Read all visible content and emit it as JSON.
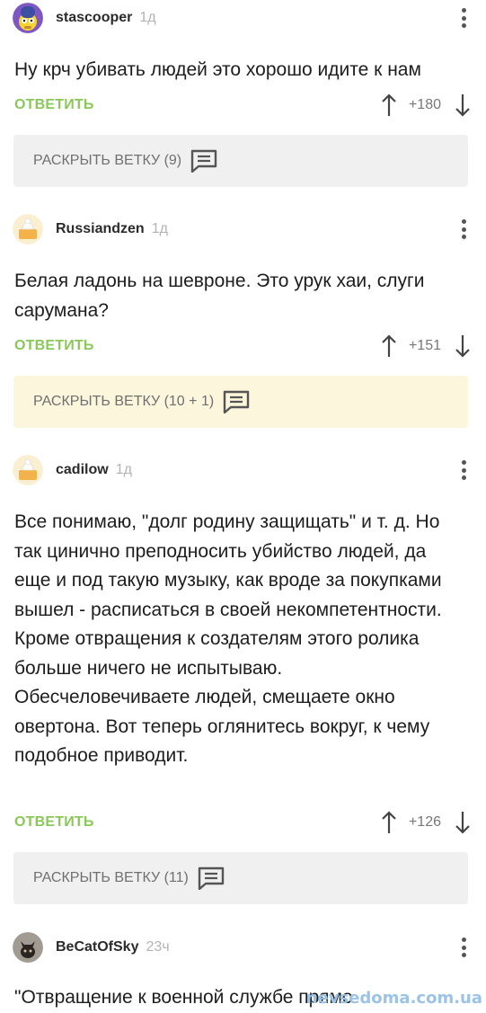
{
  "comments": [
    {
      "author": "stascooper",
      "time": "1д",
      "text": "Ну крч убивать людей это хорошо идите к нам",
      "reply_label": "ОТВЕТИТЬ",
      "score": "+180",
      "branch_label": "РАСКРЫТЬ ВЕТКУ (9)",
      "branch_color": "#f0f0f0"
    },
    {
      "author": "Russiandzen",
      "time": "1д",
      "text": "Белая ладонь на шевроне. Это урук хаи, слуги сарумана?",
      "reply_label": "ОТВЕТИТЬ",
      "score": "+151",
      "branch_label": "РАСКРЫТЬ ВЕТКУ (10 + 1)",
      "branch_color": "#fbf6dc"
    },
    {
      "author": "cadilow",
      "time": "1д",
      "text": "Все понимаю, \"долг родину защищать\" и т. д. Но так цинично преподносить убийство людей, да еще и под такую музыку, как вроде за покупками вышел - расписаться в своей некомпетентности. Кроме отвращения к создателям этого ролика больше ничего не испытываю. Обесчеловечиваете людей, смещаете окно овертона. Вот теперь оглянитесь вокруг, к чему подобное приводит.",
      "reply_label": "ОТВЕТИТЬ",
      "score": "+126",
      "branch_label": "РАСКРЫТЬ ВЕТКУ (11)",
      "branch_color": "#f0f0f0"
    },
    {
      "author": "BeCatOfSky",
      "time": "23ч",
      "text": "\"Отвращение к военной службе прямо"
    }
  ],
  "watermark": "nevsedoma.com.ua",
  "colors": {
    "reply": "#8ac858",
    "branch_gray": "#f0f0f0",
    "branch_yellow": "#fbf6dc"
  }
}
